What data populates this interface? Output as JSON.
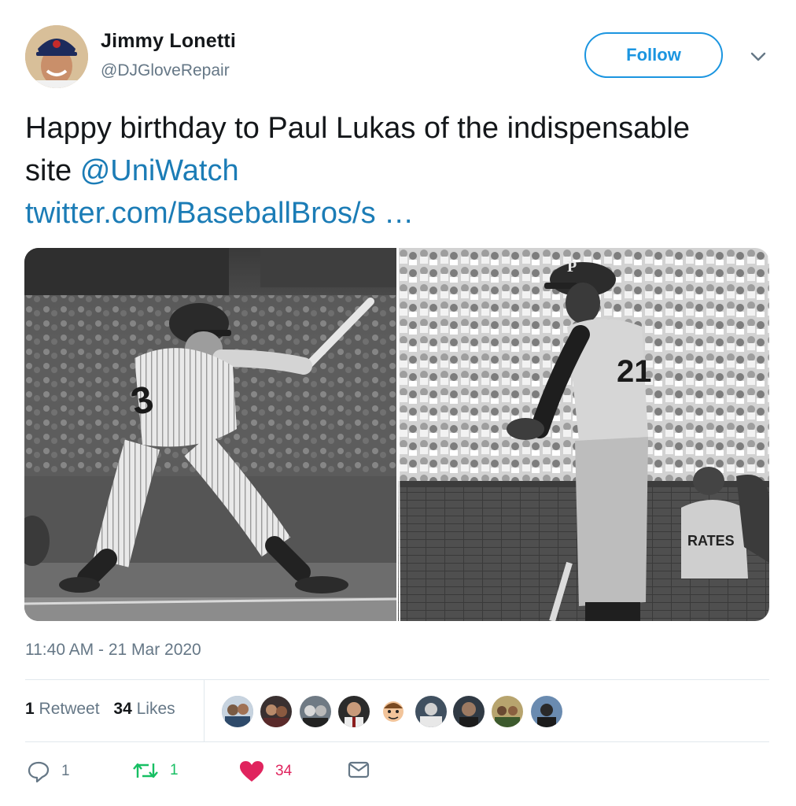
{
  "author": {
    "name": "Jimmy Lonetti",
    "handle": "@DJGloveRepair",
    "avatar_icon": "baseball-player-avatar"
  },
  "follow_button": {
    "label": "Follow",
    "color": "#1b95e0"
  },
  "menu_icon": "chevron-down-icon",
  "tweet": {
    "text_before_mention": "Happy birthday to Paul Lukas of the indispensable site ",
    "mention": "@UniWatch",
    "link": "twitter.com/BaseballBros/s …",
    "link_color": "#1b7cb6"
  },
  "media": {
    "left_photo": {
      "jersey_number": "3"
    },
    "right_photo": {
      "jersey_number": "21",
      "background_jersey_text": "RATES"
    }
  },
  "timestamp": "11:40 AM - 21 Mar 2020",
  "stats": {
    "retweets_count": "1",
    "retweets_label": "Retweet",
    "likes_count": "34",
    "likes_label": "Likes"
  },
  "likers": [
    "liker-avatar-1",
    "liker-avatar-2",
    "liker-avatar-3",
    "liker-avatar-4",
    "liker-avatar-5",
    "liker-avatar-6",
    "liker-avatar-7",
    "liker-avatar-8",
    "liker-avatar-9"
  ],
  "actions": {
    "reply": {
      "icon": "reply-icon",
      "count": "1",
      "color": "#657786"
    },
    "retweet": {
      "icon": "retweet-icon",
      "count": "1",
      "color": "#17bf63"
    },
    "like": {
      "icon": "heart-icon",
      "count": "34",
      "color": "#e0245e"
    },
    "message": {
      "icon": "envelope-icon"
    }
  }
}
